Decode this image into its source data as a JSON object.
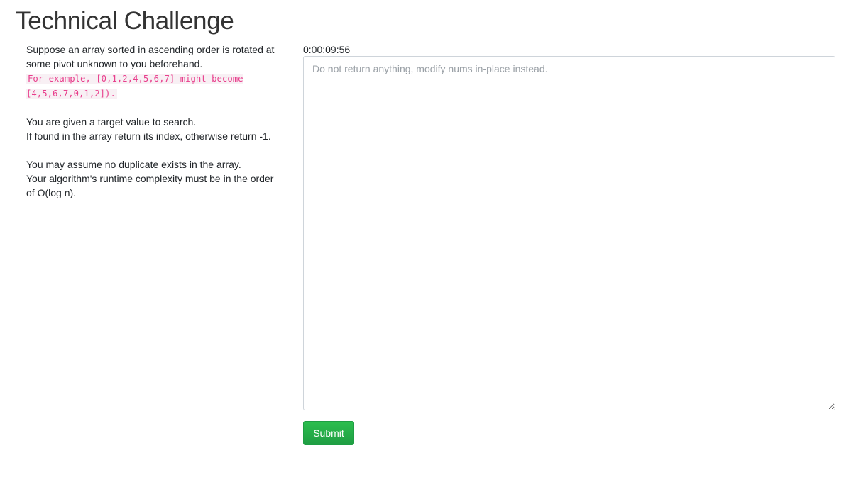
{
  "page": {
    "title": "Technical Challenge"
  },
  "problem": {
    "line1": "Suppose an array sorted in ascending order is rotated at some pivot unknown to you beforehand.",
    "example": "For example, [0,1,2,4,5,6,7] might become [4,5,6,7,0,1,2]).",
    "line2": "You are given a target value to search.",
    "line3": "If found in the array return its index, otherwise return -1.",
    "line4": "You may assume no duplicate exists in the array.",
    "line5": "Your algorithm's runtime complexity must be in the order of O(log n)."
  },
  "timer": {
    "value": "0:00:09:56"
  },
  "editor": {
    "value": "",
    "placeholder": "Do not return anything, modify nums in-place instead."
  },
  "actions": {
    "submit_label": "Submit"
  },
  "colors": {
    "code_text": "#e83e8c",
    "submit_bg": "#28a745"
  }
}
